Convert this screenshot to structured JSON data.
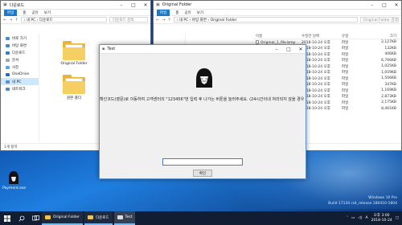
{
  "left_window": {
    "title": "다운로드",
    "ribbon": [
      "파일",
      "홈",
      "공유",
      "보기"
    ],
    "address": "› 내 PC › 다운로드",
    "search_placeholder": "다운로드 검색",
    "nav": [
      "바로 가기",
      "바탕 화면",
      "다운로드",
      "문서",
      "사진",
      "OneDrive",
      "내 PC",
      "네트워크"
    ],
    "folders": [
      "Original Folder",
      "원본 폴더"
    ],
    "status": "1개 항목"
  },
  "right_window": {
    "title": "Original Folder",
    "ribbon": [
      "파일",
      "홈",
      "공유",
      "보기"
    ],
    "address": "› 내 PC › 바탕 화면 › Original Folder",
    "search_placeholder": "Original Folder 검색",
    "columns": [
      "이름",
      "수정한 날짜",
      "유형",
      "크기"
    ],
    "files": [
      {
        "name": "Original_1_file.bmp",
        "date": "2018-10-24 오후",
        "type": "파일",
        "size": "2,127KB"
      },
      {
        "name": "",
        "date": "2018-10-24 오후",
        "type": "파일",
        "size": "132KB"
      },
      {
        "name": "",
        "date": "2018-10-24 오후",
        "type": "파일",
        "size": "406KB"
      },
      {
        "name": "",
        "date": "2018-10-24 오후",
        "type": "파일",
        "size": "6,766KB"
      },
      {
        "name": "",
        "date": "2018-10-24 오후",
        "type": "파일",
        "size": "1,025KB"
      },
      {
        "name": "",
        "date": "2018-10-24 오후",
        "type": "파일",
        "size": "1,059KB"
      },
      {
        "name": "",
        "date": "2018-10-24 오후",
        "type": "파일",
        "size": "1,506KB"
      },
      {
        "name": "",
        "date": "2018-10-24 오후",
        "type": "파일",
        "size": "347KB"
      },
      {
        "name": "",
        "date": "2018-10-24 오후",
        "type": "파일",
        "size": "1,169KB"
      },
      {
        "name": "",
        "date": "2018-10-24 오후",
        "type": "파일",
        "size": "2,873KB"
      },
      {
        "name": "",
        "date": "2018-10-24 오후",
        "type": "파일",
        "size": "2,175KB"
      },
      {
        "name": "",
        "date": "2018-10-24 오후",
        "type": "파일",
        "size": "8,461KB"
      }
    ]
  },
  "dialog": {
    "title": "Test",
    "message": "확인코드(영문)로 이동하여 고객센터의 \"123456\"번 입력 후 나가는 버튼을 눌러주세요. (24시간이내 처리되지 않을 경우 파일삭제)",
    "button": "확인"
  },
  "desktop": {
    "icon_label": "Payment.exe",
    "watermark_line1": "Windows 10 Pro",
    "watermark_line2": "Build 17134.rs4_release.180410-1804"
  },
  "taskbar": {
    "apps": [
      "Original Folder",
      "다운로드",
      "Test"
    ],
    "time": "오후 3:00",
    "date": "2018-10-24",
    "ime": "A"
  },
  "colors": {
    "accent": "#1979ca",
    "folder": "#f6cf62",
    "taskbar": "#101d33"
  }
}
